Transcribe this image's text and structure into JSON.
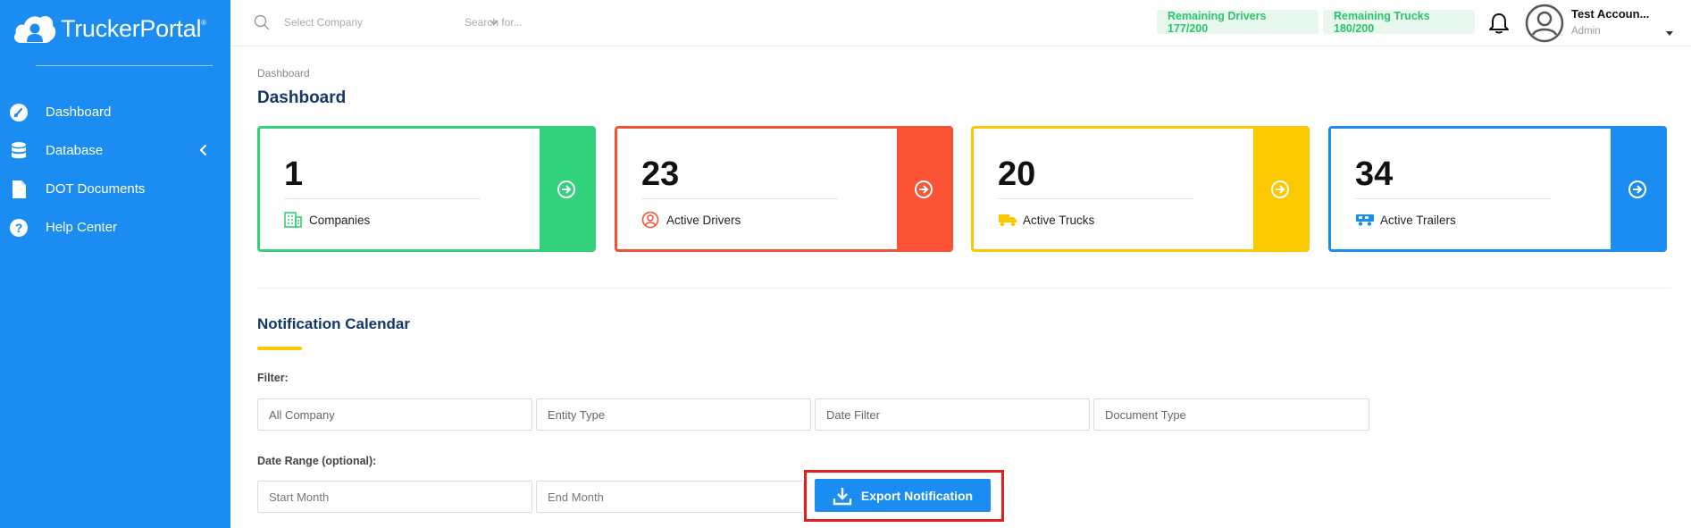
{
  "app": {
    "brand": "TruckerPortal",
    "brand_mark": "®"
  },
  "sidebar": {
    "items": [
      {
        "label": "Dashboard",
        "icon": "gauge-icon"
      },
      {
        "label": "Database",
        "icon": "database-icon",
        "has_chevron": true
      },
      {
        "label": "DOT Documents",
        "icon": "document-icon"
      },
      {
        "label": "Help Center",
        "icon": "help-icon"
      }
    ]
  },
  "topbar": {
    "company_select_placeholder": "Select Company",
    "search_placeholder": "Search for...",
    "remaining_drivers": "Remaining Drivers 177/200",
    "remaining_trucks": "Remaining Trucks 180/200",
    "user_name": "Test Accoun...",
    "user_role": "Admin"
  },
  "main": {
    "breadcrumb": "Dashboard",
    "title": "Dashboard",
    "cards": [
      {
        "value": "1",
        "label": "Companies",
        "color": "#32d17b"
      },
      {
        "value": "23",
        "label": "Active Drivers",
        "color": "#fa5336"
      },
      {
        "value": "20",
        "label": "Active Trucks",
        "color": "#fcc800"
      },
      {
        "value": "34",
        "label": "Active Trailers",
        "color": "#1b8cf2"
      }
    ],
    "calendar": {
      "title": "Notification Calendar",
      "filter_label": "Filter:",
      "filters": [
        "All Company",
        "Entity Type",
        "Date Filter",
        "Document Type"
      ],
      "date_range_label": "Date Range (optional):",
      "start_placeholder": "Start Month",
      "end_placeholder": "End Month",
      "export_label": "Export Notification"
    }
  },
  "colors": {
    "sidebar": "#1b8cf2",
    "title": "#13376b",
    "pill_bg": "#e9f8ef",
    "pill_text": "#2bc46c",
    "highlight": "#e0201f"
  }
}
